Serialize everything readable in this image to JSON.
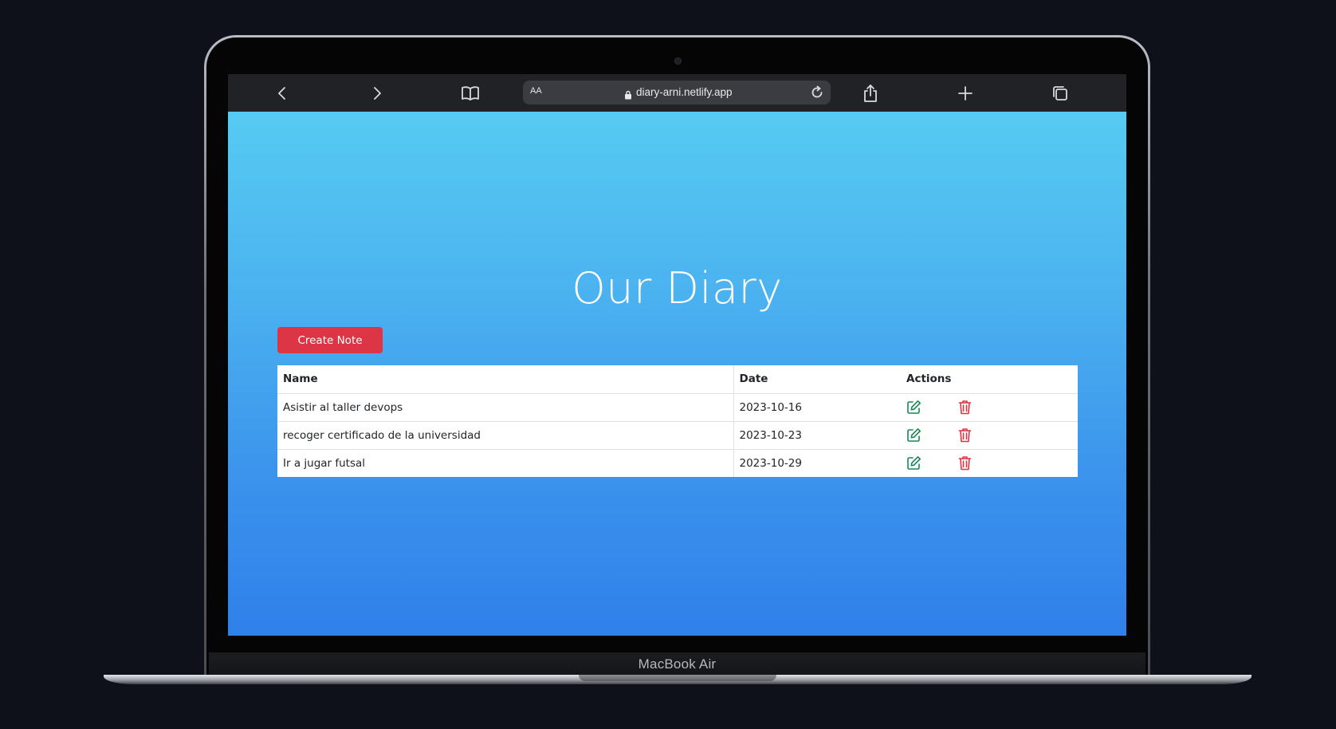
{
  "device": {
    "label": "MacBook Air"
  },
  "browser": {
    "text_size_label": "AA",
    "url": "diary-arni.netlify.app",
    "icons": [
      "back-icon",
      "forward-icon",
      "bookmarks-icon",
      "lock-icon",
      "reload-icon",
      "share-icon",
      "new-tab-icon",
      "tabs-icon"
    ]
  },
  "page": {
    "title": "Our Diary",
    "create_button": "Create Note",
    "colors": {
      "gradient_top": "#56cbf2",
      "gradient_bottom": "#2f80ea",
      "danger": "#dc3545",
      "success": "#198754"
    },
    "table": {
      "headers": {
        "name": "Name",
        "date": "Date",
        "actions": "Actions"
      },
      "rows": [
        {
          "name": "Asistir al taller devops",
          "date": "2023-10-16"
        },
        {
          "name": "recoger certificado de la universidad",
          "date": "2023-10-23"
        },
        {
          "name": "Ir a jugar futsal",
          "date": "2023-10-29"
        }
      ]
    }
  }
}
